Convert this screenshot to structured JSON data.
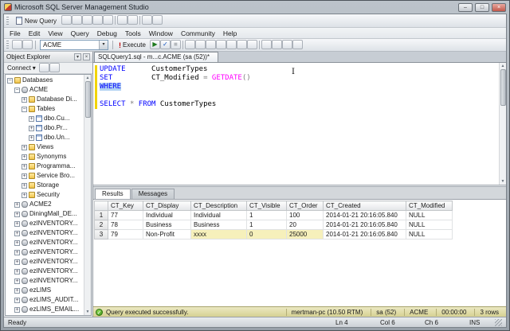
{
  "window": {
    "title": "Microsoft SQL Server Management Studio"
  },
  "icons": {
    "minimize": "–",
    "maximize": "□",
    "close": "×",
    "dropdown": "▾",
    "panel_position": "▾",
    "panel_close": "×",
    "execute_bang": "!",
    "success_check": "✓",
    "scroll_up": "▲",
    "scroll_down": "▼",
    "ibeam": "I"
  },
  "icon_glyphs": {
    "debug": "▶",
    "parse": "✓",
    "cancel-query": "■"
  },
  "toolbars": {
    "main": [
      "database-engine-query",
      "analysis-services-query",
      "open-file",
      "save",
      "save-all",
      "sep",
      "print",
      "activity-monitor",
      "sep",
      "registered-servers",
      "solution-explorer"
    ],
    "query_left": [
      "connect-database",
      "change-connection"
    ],
    "query_right": [
      "debug",
      "parse",
      "cancel-query",
      "sep",
      "query-options",
      "intellisense",
      "include-actual-plan",
      "include-client-statistics",
      "results-to-text",
      "results-to-grid",
      "results-to-file",
      "sep",
      "comment-out",
      "uncomment",
      "decrease-indent",
      "increase-indent"
    ],
    "oe": [
      "refresh",
      "filter"
    ]
  },
  "menu": {
    "items": [
      "File",
      "Edit",
      "View",
      "Query",
      "Debug",
      "Tools",
      "Window",
      "Community",
      "Help"
    ]
  },
  "toolbar_main": {
    "new_query": "New Query"
  },
  "toolbar_query": {
    "database": "ACME",
    "execute": "Execute"
  },
  "object_explorer": {
    "title": "Object Explorer",
    "connect": "Connect",
    "tree": [
      {
        "label": "Databases",
        "level": 0,
        "expand": "minus",
        "icon": "folder"
      },
      {
        "label": "ACME",
        "level": 1,
        "expand": "minus",
        "icon": "database"
      },
      {
        "label": "Database Di...",
        "level": 2,
        "expand": "plus",
        "icon": "folder"
      },
      {
        "label": "Tables",
        "level": 2,
        "expand": "minus",
        "icon": "folder"
      },
      {
        "label": "dbo.Cu...",
        "level": 3,
        "expand": "plus",
        "icon": "table"
      },
      {
        "label": "dbo.Pr...",
        "level": 3,
        "expand": "plus",
        "icon": "table"
      },
      {
        "label": "dbo.Un...",
        "level": 3,
        "expand": "plus",
        "icon": "table"
      },
      {
        "label": "Views",
        "level": 2,
        "expand": "plus",
        "icon": "folder"
      },
      {
        "label": "Synonyms",
        "level": 2,
        "expand": "plus",
        "icon": "folder"
      },
      {
        "label": "Programma...",
        "level": 2,
        "expand": "plus",
        "icon": "folder"
      },
      {
        "label": "Service Bro...",
        "level": 2,
        "expand": "plus",
        "icon": "folder"
      },
      {
        "label": "Storage",
        "level": 2,
        "expand": "plus",
        "icon": "folder"
      },
      {
        "label": "Security",
        "level": 2,
        "expand": "plus",
        "icon": "folder"
      },
      {
        "label": "ACME2",
        "level": 1,
        "expand": "plus",
        "icon": "database"
      },
      {
        "label": "DiningMall_DE...",
        "level": 1,
        "expand": "plus",
        "icon": "database"
      },
      {
        "label": "ezINVENTORY...",
        "level": 1,
        "expand": "plus",
        "icon": "database"
      },
      {
        "label": "ezINVENTORY...",
        "level": 1,
        "expand": "plus",
        "icon": "database"
      },
      {
        "label": "ezINVENTORY...",
        "level": 1,
        "expand": "plus",
        "icon": "database"
      },
      {
        "label": "ezINVENTORY...",
        "level": 1,
        "expand": "plus",
        "icon": "database"
      },
      {
        "label": "ezINVENTORY...",
        "level": 1,
        "expand": "plus",
        "icon": "database"
      },
      {
        "label": "ezINVENTORY...",
        "level": 1,
        "expand": "plus",
        "icon": "database"
      },
      {
        "label": "ezINVENTORY...",
        "level": 1,
        "expand": "plus",
        "icon": "database"
      },
      {
        "label": "ezLIMS",
        "level": 1,
        "expand": "plus",
        "icon": "database"
      },
      {
        "label": "ezLIMS_AUDIT...",
        "level": 1,
        "expand": "plus",
        "icon": "database"
      },
      {
        "label": "ezLIMS_EMAIL...",
        "level": 1,
        "expand": "plus",
        "icon": "database"
      }
    ]
  },
  "editor": {
    "tab": "SQLQuery1.sql - m...c.ACME (sa (52))*",
    "lines": [
      {
        "changed": true,
        "tokens": [
          {
            "t": "UPDATE",
            "y": "k"
          },
          {
            "t": "      CustomerTypes",
            "y": "p"
          }
        ]
      },
      {
        "changed": true,
        "tokens": [
          {
            "t": "SET",
            "y": "k"
          },
          {
            "t": "         CT_Modified ",
            "y": "p"
          },
          {
            "t": "=",
            "y": "o"
          },
          {
            "t": " ",
            "y": "p"
          },
          {
            "t": "GETDATE",
            "y": "f"
          },
          {
            "t": "()",
            "y": "o"
          }
        ]
      },
      {
        "changed": true,
        "tokens": [
          {
            "t": "WHERE",
            "y": "k",
            "sel": true
          }
        ]
      },
      {
        "changed": true,
        "tokens": []
      },
      {
        "changed": true,
        "tokens": [
          {
            "t": "SELECT ",
            "y": "k"
          },
          {
            "t": "*",
            "y": "o"
          },
          {
            "t": " ",
            "y": "p"
          },
          {
            "t": "FROM",
            "y": "k"
          },
          {
            "t": " CustomerTypes",
            "y": "p"
          }
        ]
      }
    ]
  },
  "results": {
    "tabs": [
      "Results",
      "Messages"
    ],
    "active_tab": "Results",
    "columns": [
      "",
      "CT_Key",
      "CT_Display",
      "CT_Description",
      "CT_Visible",
      "CT_Order",
      "CT_Created",
      "CT_Modified"
    ],
    "rows": [
      {
        "num": "1",
        "cells": [
          "77",
          "Individual",
          "Individual",
          "1",
          "100",
          "2014-01-21 20:16:05.840",
          "NULL"
        ]
      },
      {
        "num": "2",
        "cells": [
          "78",
          "Business",
          "Business",
          "1",
          "20",
          "2014-01-21 20:16:05.840",
          "NULL"
        ]
      },
      {
        "num": "3",
        "cells": [
          "79",
          "Non-Profit",
          "xxxx",
          "0",
          "25000",
          "2014-01-21 20:16:05.840",
          "NULL"
        ]
      }
    ],
    "highlights": [
      {
        "row": 2,
        "cols": [
          2,
          3,
          4
        ]
      }
    ]
  },
  "status": {
    "message": "Query executed successfully.",
    "server": "mertman-pc (10.50 RTM)",
    "login": "sa (52)",
    "database": "ACME",
    "duration": "00:00:00",
    "rowcount": "3 rows"
  },
  "statusbar2": {
    "state": "Ready",
    "ln": "Ln 4",
    "col": "Col 6",
    "ch": "Ch 6",
    "mode": "INS"
  }
}
